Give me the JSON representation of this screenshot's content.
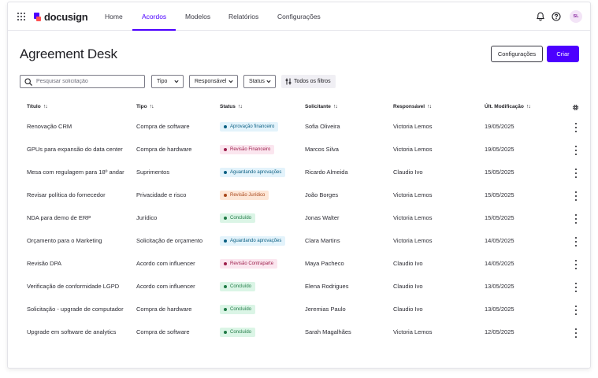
{
  "app": {
    "brand": "docusign"
  },
  "nav": {
    "home": "Home",
    "acordos": "Acordos",
    "modelos": "Modelos",
    "relatorios": "Relatórios",
    "configuracoes": "Configurações"
  },
  "user": {
    "initials": "SL"
  },
  "page": {
    "title": "Agreement Desk",
    "config_button": "Configurações",
    "create_button": "Criar"
  },
  "filters": {
    "search_placeholder": "Pesquisar solicitação",
    "tipo": "Tipo",
    "responsavel": "Responsável",
    "status": "Status",
    "all_filters": "Todos os filtros"
  },
  "table": {
    "headers": {
      "titulo": "Título",
      "tipo": "Tipo",
      "status": "Status",
      "solicitante": "Solicitante",
      "responsavel": "Responsável",
      "modificacao": "Últ. Modificação"
    },
    "rows": [
      {
        "titulo": "Renovação CRM",
        "tipo": "Compra de software",
        "status": "Aprovação financeiro",
        "status_color": "blue",
        "solicitante": "Sofia Oliveira",
        "responsavel": "Victoria Lemos",
        "data": "19/05/2025"
      },
      {
        "titulo": "GPUs para expansão do data center",
        "tipo": "Compra de hardware",
        "status": "Revisão Financeiro",
        "status_color": "pink",
        "solicitante": "Marcos Silva",
        "responsavel": "Victoria Lemos",
        "data": "19/05/2025"
      },
      {
        "titulo": "Mesa com regulagem para 18º andar",
        "tipo": "Suprimentos",
        "status": "Aguardando aprovações",
        "status_color": "blue",
        "solicitante": "Ricardo Almeida",
        "responsavel": "Claudio Ivo",
        "data": "15/05/2025"
      },
      {
        "titulo": "Revisar política do fornecedor",
        "tipo": "Privacidade e risco",
        "status": "Revisão Jurídico",
        "status_color": "orange",
        "solicitante": "João Borges",
        "responsavel": "Victoria Lemos",
        "data": "15/05/2025"
      },
      {
        "titulo": "NDA para demo de ERP",
        "tipo": "Jurídico",
        "status": "Concluído",
        "status_color": "green",
        "solicitante": "Jonas Walter",
        "responsavel": "Victoria Lemos",
        "data": "15/05/2025"
      },
      {
        "titulo": "Orçamento para o Marketing",
        "tipo": "Solicitação de orçamento",
        "status": "Aguardando aprovações",
        "status_color": "blue",
        "solicitante": "Clara Martins",
        "responsavel": "Victoria Lemos",
        "data": "14/05/2025"
      },
      {
        "titulo": "Revisão DPA",
        "tipo": "Acordo com influencer",
        "status": "Revisão Contraparte",
        "status_color": "pink",
        "solicitante": "Maya Pacheco",
        "responsavel": "Claudio Ivo",
        "data": "14/05/2025"
      },
      {
        "titulo": "Verificação de conformidade LGPD",
        "tipo": "Acordo com influencer",
        "status": "Concluído",
        "status_color": "green",
        "solicitante": "Elena Rodrigues",
        "responsavel": "Claudio Ivo",
        "data": "13/05/2025"
      },
      {
        "titulo": "Solicitação - upgrade de computador",
        "tipo": "Compra de hardware",
        "status": "Concluído",
        "status_color": "green",
        "solicitante": "Jeremias Paulo",
        "responsavel": "Claudio Ivo",
        "data": "13/05/2025"
      },
      {
        "titulo": "Upgrade em software de analytics",
        "tipo": "Compra de software",
        "status": "Concluído",
        "status_color": "green",
        "solicitante": "Sarah Magalhães",
        "responsavel": "Victoria Lemos",
        "data": "12/05/2025"
      }
    ]
  },
  "icons": {
    "apps": "apps-grid-icon",
    "bell": "bell-icon",
    "help": "help-icon",
    "search": "search-icon",
    "filter": "filter-sliders-icon",
    "settings": "gear-icon",
    "more": "kebab-menu-icon"
  },
  "colors": {
    "accent": "#4c00ff"
  }
}
